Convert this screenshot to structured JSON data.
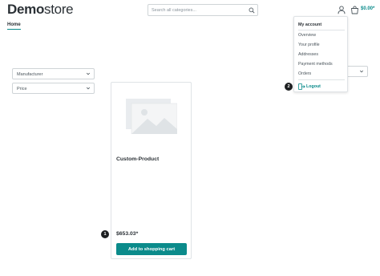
{
  "header": {
    "logo_bold": "Demo",
    "logo_rest": "store",
    "search_placeholder": "Search all categories...",
    "cart_total": "$0.00*"
  },
  "nav": {
    "home": "Home"
  },
  "filters": [
    {
      "label": "Manufacturer"
    },
    {
      "label": "Price"
    }
  ],
  "product": {
    "name": "Custom-Product",
    "price": "$653.03*",
    "button": "Add to shopping cart"
  },
  "account_menu": {
    "title": "My account",
    "items": [
      "Overview",
      "Your profile",
      "Addresses",
      "Payment methods",
      "Orders"
    ],
    "logout": "Logout"
  },
  "markers": [
    "1",
    "2"
  ],
  "colors": {
    "accent": "#0b8b8b",
    "text": "#4a545b",
    "border": "#cfd4d7"
  }
}
